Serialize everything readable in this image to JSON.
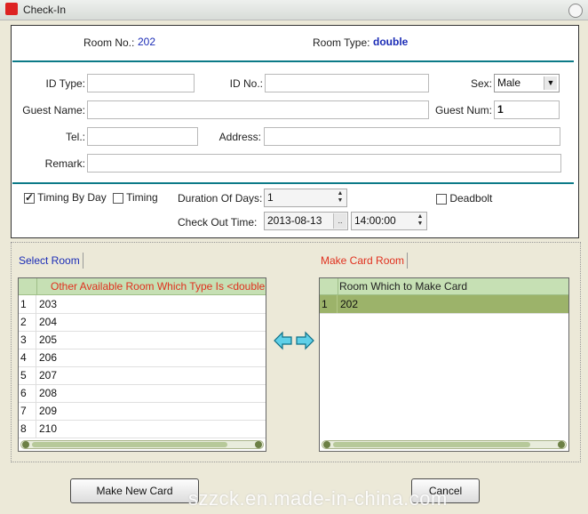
{
  "window": {
    "title": "Check-In"
  },
  "room": {
    "no_label": "Room No.:",
    "no_value": "202",
    "type_label": "Room Type:",
    "type_value": "double"
  },
  "form": {
    "id_type_label": "ID Type:",
    "id_no_label": "ID No.:",
    "sex_label": "Sex:",
    "sex_value": "Male",
    "guest_name_label": "Guest Name:",
    "guest_num_label": "Guest Num:",
    "guest_num_value": "1",
    "tel_label": "Tel.:",
    "address_label": "Address:",
    "remark_label": "Remark:"
  },
  "timing": {
    "by_day_label": "Timing By Day",
    "by_day_checked": true,
    "timing_label": "Timing",
    "timing_checked": false,
    "duration_label": "Duration Of Days:",
    "duration_value": "1",
    "deadbolt_label": "Deadbolt",
    "deadbolt_checked": false,
    "checkout_label": "Check Out Time:",
    "checkout_date": "2013-08-13",
    "checkout_time": "14:00:00"
  },
  "select_room": {
    "tab_label": "Select Room",
    "column_header": "Other Available Room Which Type Is <double",
    "rows": [
      {
        "num": "1",
        "room": "203"
      },
      {
        "num": "2",
        "room": "204"
      },
      {
        "num": "3",
        "room": "205"
      },
      {
        "num": "4",
        "room": "206"
      },
      {
        "num": "5",
        "room": "207"
      },
      {
        "num": "6",
        "room": "208"
      },
      {
        "num": "7",
        "room": "209"
      },
      {
        "num": "8",
        "room": "210"
      }
    ]
  },
  "make_card_room": {
    "tab_label": "Make Card Room",
    "column_header": "Room Which to Make Card",
    "rows": [
      {
        "num": "1",
        "room": "202"
      }
    ]
  },
  "buttons": {
    "make_new_card": "Make New Card",
    "cancel": "Cancel"
  },
  "watermark": "szzck.en.made-in-china.com",
  "colors": {
    "accent_teal": "#0c7a88",
    "grid_header": "#c6e0b4",
    "selected_row": "#9cb36a",
    "header_red": "#e0301e",
    "value_blue": "#1b2cb6"
  }
}
